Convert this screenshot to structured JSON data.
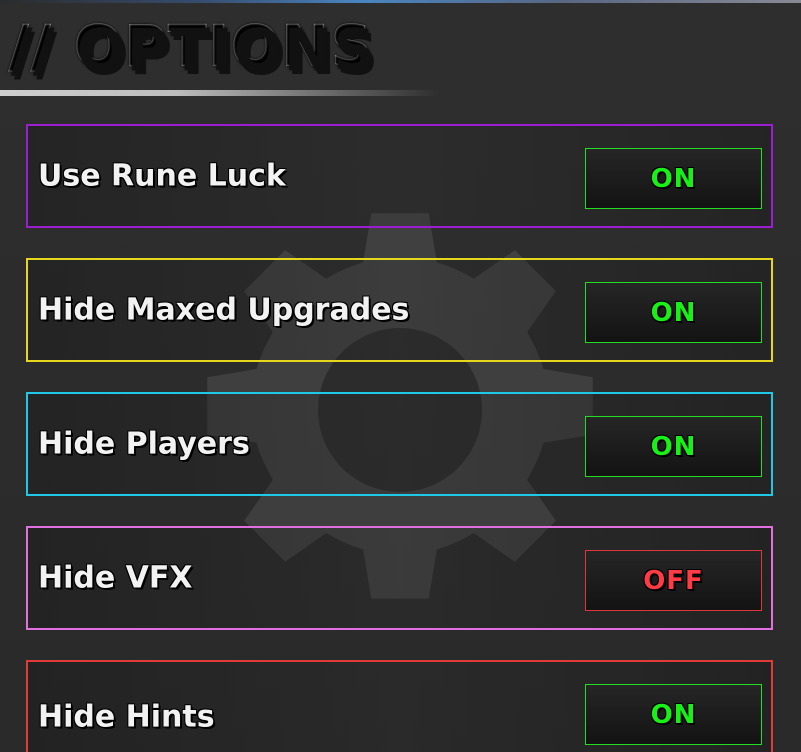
{
  "header": {
    "title": "// OPTIONS"
  },
  "colors": {
    "on": "#18f018",
    "off": "#ff3b45",
    "row_borders": [
      "#9a1fd0",
      "#e6d61c",
      "#1ec8e6",
      "#e070e0",
      "#e03a3a"
    ]
  },
  "options": [
    {
      "label": "Use Rune Luck",
      "state": "ON"
    },
    {
      "label": "Hide Maxed Upgrades",
      "state": "ON"
    },
    {
      "label": "Hide Players",
      "state": "ON"
    },
    {
      "label": "Hide VFX",
      "state": "OFF"
    },
    {
      "label": "Hide Hints",
      "state": "ON"
    }
  ],
  "icons": {
    "background": "gear-icon"
  }
}
